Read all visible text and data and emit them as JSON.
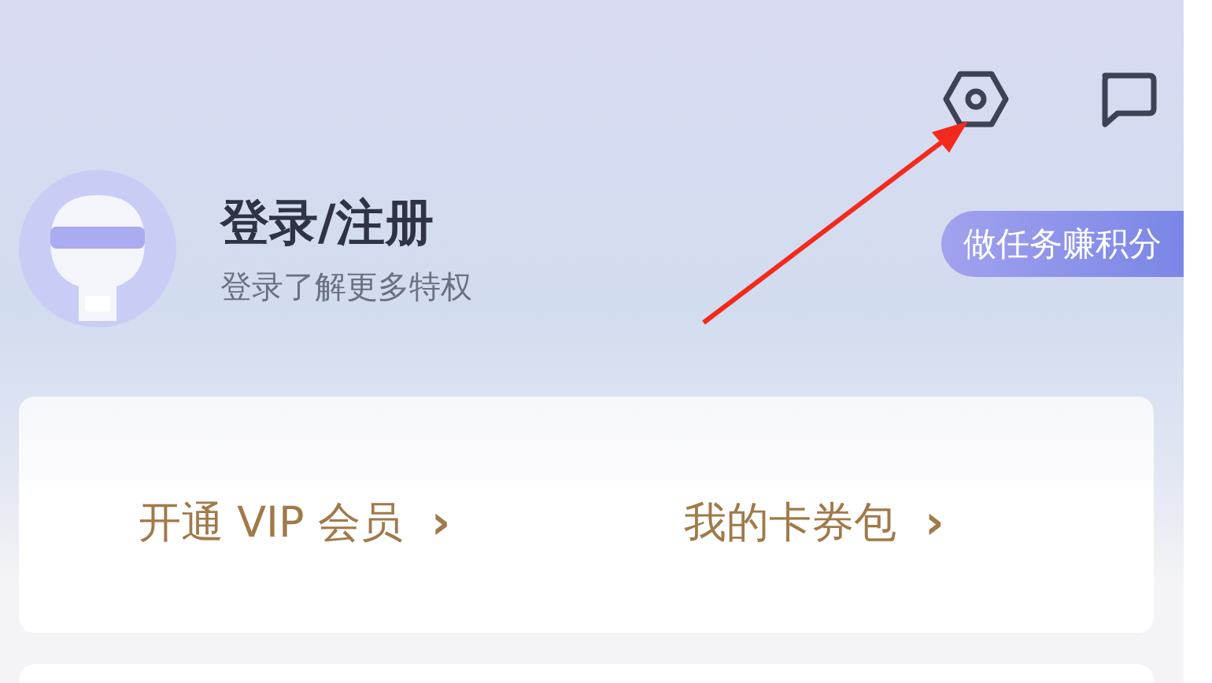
{
  "header": {
    "icons": [
      {
        "kind": "settings"
      },
      {
        "kind": "message"
      }
    ]
  },
  "profile": {
    "title": "登录/注册",
    "subtitle": "登录了解更多特权"
  },
  "task_button": {
    "label": "做任务赚积分"
  },
  "card": {
    "links": [
      {
        "label": "开通 VIP 会员",
        "chevron": "›"
      },
      {
        "label": "我的卡券包",
        "chevron": "›"
      }
    ]
  },
  "annotation": {
    "kind": "arrow"
  }
}
